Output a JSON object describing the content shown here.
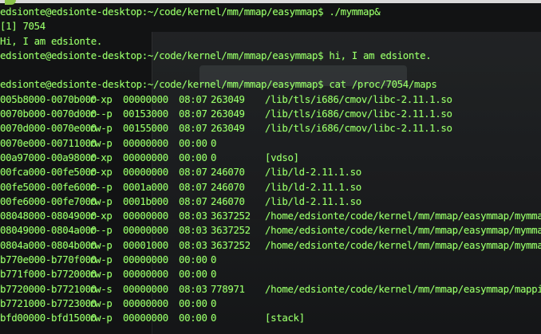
{
  "terminal": {
    "text_color": "#9bff6b",
    "background": "#121314",
    "lines": [
      "edsionte@edsionte-desktop:~/code/kernel/mm/mmap/easymmap$ ./mymmap&",
      "[1] 7054",
      "Hi, I am edsionte.",
      "edsionte@edsionte-desktop:~/code/kernel/mm/mmap/easymmap$ hi, I am edsionte.",
      "",
      "edsionte@edsionte-desktop:~/code/kernel/mm/mmap/easymmap$ cat /proc/7054/maps"
    ],
    "maps": [
      {
        "addr": "005b8000-0070b000",
        "perm": "r-xp",
        "offset": "00000000",
        "dev": "08:07",
        "inode": "263049",
        "path": "/lib/tls/i686/cmov/libc-2.11.1.so"
      },
      {
        "addr": "0070b000-0070d000",
        "perm": "r--p",
        "offset": "00153000",
        "dev": "08:07",
        "inode": "263049",
        "path": "/lib/tls/i686/cmov/libc-2.11.1.so"
      },
      {
        "addr": "0070d000-0070e000",
        "perm": "rw-p",
        "offset": "00155000",
        "dev": "08:07",
        "inode": "263049",
        "path": "/lib/tls/i686/cmov/libc-2.11.1.so"
      },
      {
        "addr": "0070e000-00711000",
        "perm": "rw-p",
        "offset": "00000000",
        "dev": "00:00",
        "inode": "0",
        "path": ""
      },
      {
        "addr": "00a97000-00a98000",
        "perm": "r-xp",
        "offset": "00000000",
        "dev": "00:00",
        "inode": "0",
        "path": "[vdso]"
      },
      {
        "addr": "00fca000-00fe5000",
        "perm": "r-xp",
        "offset": "00000000",
        "dev": "08:07",
        "inode": "246070",
        "path": "/lib/ld-2.11.1.so"
      },
      {
        "addr": "00fe5000-00fe6000",
        "perm": "r--p",
        "offset": "0001a000",
        "dev": "08:07",
        "inode": "246070",
        "path": "/lib/ld-2.11.1.so"
      },
      {
        "addr": "00fe6000-00fe7000",
        "perm": "rw-p",
        "offset": "0001b000",
        "dev": "08:07",
        "inode": "246070",
        "path": "/lib/ld-2.11.1.so"
      },
      {
        "addr": "08048000-08049000",
        "perm": "r-xp",
        "offset": "00000000",
        "dev": "08:03",
        "inode": "3637252",
        "path": "/home/edsionte/code/kernel/mm/mmap/easymmap/mymmap"
      },
      {
        "addr": "08049000-0804a000",
        "perm": "r--p",
        "offset": "00000000",
        "dev": "08:03",
        "inode": "3637252",
        "path": "/home/edsionte/code/kernel/mm/mmap/easymmap/mymmap"
      },
      {
        "addr": "0804a000-0804b000",
        "perm": "rw-p",
        "offset": "00001000",
        "dev": "08:03",
        "inode": "3637252",
        "path": "/home/edsionte/code/kernel/mm/mmap/easymmap/mymmap"
      },
      {
        "addr": "b770e000-b770f000",
        "perm": "rw-p",
        "offset": "00000000",
        "dev": "00:00",
        "inode": "0",
        "path": ""
      },
      {
        "addr": "b771f000-b7720000",
        "perm": "rw-p",
        "offset": "00000000",
        "dev": "00:00",
        "inode": "0",
        "path": ""
      },
      {
        "addr": "b7720000-b7721000",
        "perm": "rw-s",
        "offset": "00000000",
        "dev": "08:03",
        "inode": "778971",
        "path": "/home/edsionte/code/kernel/mm/mmap/easymmap/mapping_file.txt"
      },
      {
        "addr": "b7721000-b7723000",
        "perm": "rw-p",
        "offset": "00000000",
        "dev": "00:00",
        "inode": "0",
        "path": ""
      },
      {
        "addr": "bfd00000-bfd15000",
        "perm": "rw-p",
        "offset": "00000000",
        "dev": "00:00",
        "inode": "0",
        "path": "[stack]"
      }
    ]
  }
}
